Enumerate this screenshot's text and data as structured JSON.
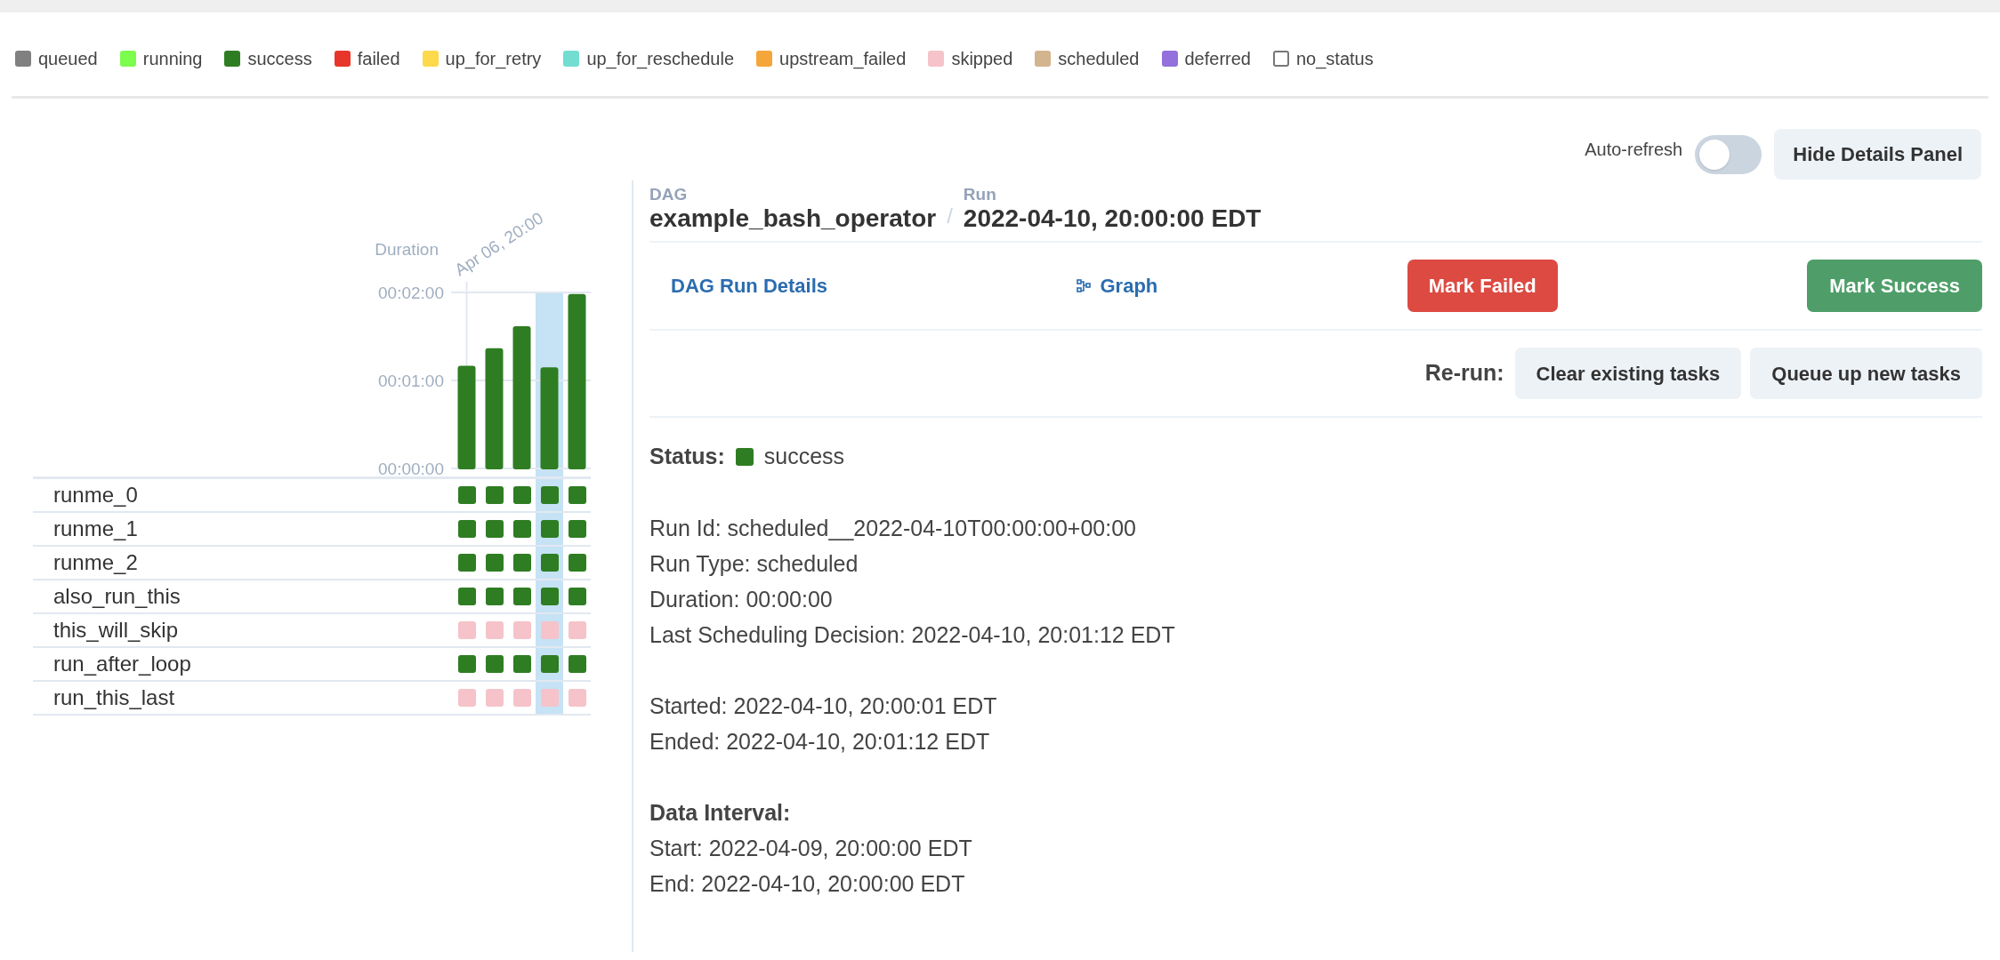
{
  "legend": [
    {
      "label": "queued",
      "color": "#808080",
      "kind": "filled"
    },
    {
      "label": "running",
      "color": "#7cfc4c",
      "kind": "filled"
    },
    {
      "label": "success",
      "color": "#2f7d22",
      "kind": "filled"
    },
    {
      "label": "failed",
      "color": "#e8352a",
      "kind": "filled"
    },
    {
      "label": "up_for_retry",
      "color": "#fdd94b",
      "kind": "filled"
    },
    {
      "label": "up_for_reschedule",
      "color": "#72ddd0",
      "kind": "filled"
    },
    {
      "label": "upstream_failed",
      "color": "#f5a63a",
      "kind": "filled"
    },
    {
      "label": "skipped",
      "color": "#f5c3c9",
      "kind": "filled"
    },
    {
      "label": "scheduled",
      "color": "#d2b48e",
      "kind": "filled"
    },
    {
      "label": "deferred",
      "color": "#9370db",
      "kind": "filled"
    },
    {
      "label": "no_status",
      "color": "#ffffff",
      "kind": "outlined"
    }
  ],
  "auto_refresh": {
    "label": "Auto-refresh",
    "on": false
  },
  "hide_details_button": "Hide Details Panel",
  "grid": {
    "chart_data": {
      "type": "bar",
      "ylabel": "Duration",
      "ylim": [
        0,
        120
      ],
      "yticks": [
        {
          "value": 0,
          "label": "00:00:00"
        },
        {
          "value": 60,
          "label": "00:01:00"
        },
        {
          "value": 120,
          "label": "00:02:00"
        }
      ],
      "values": [
        70,
        82,
        97,
        69,
        119
      ]
    },
    "first_run_label": "Apr 06, 20:00",
    "runs": [
      {
        "selected": false
      },
      {
        "selected": false
      },
      {
        "selected": false
      },
      {
        "selected": true
      },
      {
        "selected": false
      }
    ],
    "tasks": [
      {
        "name": "runme_0",
        "cells": [
          {
            "color": "#2f7d22"
          },
          {
            "color": "#2f7d22"
          },
          {
            "color": "#2f7d22"
          },
          {
            "color": "#2f7d22"
          },
          {
            "color": "#2f7d22"
          }
        ]
      },
      {
        "name": "runme_1",
        "cells": [
          {
            "color": "#2f7d22"
          },
          {
            "color": "#2f7d22"
          },
          {
            "color": "#2f7d22"
          },
          {
            "color": "#2f7d22"
          },
          {
            "color": "#2f7d22"
          }
        ]
      },
      {
        "name": "runme_2",
        "cells": [
          {
            "color": "#2f7d22"
          },
          {
            "color": "#2f7d22"
          },
          {
            "color": "#2f7d22"
          },
          {
            "color": "#2f7d22"
          },
          {
            "color": "#2f7d22"
          }
        ]
      },
      {
        "name": "also_run_this",
        "cells": [
          {
            "color": "#2f7d22"
          },
          {
            "color": "#2f7d22"
          },
          {
            "color": "#2f7d22"
          },
          {
            "color": "#2f7d22"
          },
          {
            "color": "#2f7d22"
          }
        ]
      },
      {
        "name": "this_will_skip",
        "cells": [
          {
            "color": "#f5c3c9"
          },
          {
            "color": "#f5c3c9"
          },
          {
            "color": "#f5c3c9"
          },
          {
            "color": "#f5c3c9"
          },
          {
            "color": "#f5c3c9"
          }
        ]
      },
      {
        "name": "run_after_loop",
        "cells": [
          {
            "color": "#2f7d22"
          },
          {
            "color": "#2f7d22"
          },
          {
            "color": "#2f7d22"
          },
          {
            "color": "#2f7d22"
          },
          {
            "color": "#2f7d22"
          }
        ]
      },
      {
        "name": "run_this_last",
        "cells": [
          {
            "color": "#f5c3c9"
          },
          {
            "color": "#f5c3c9"
          },
          {
            "color": "#f5c3c9"
          },
          {
            "color": "#f5c3c9"
          },
          {
            "color": "#f5c3c9"
          }
        ]
      }
    ]
  },
  "details": {
    "breadcrumb": [
      {
        "label": "DAG",
        "value": "example_bash_operator"
      },
      {
        "label": "Run",
        "value": "2022-04-10, 20:00:00 EDT"
      }
    ],
    "separator": "/",
    "actions": [
      {
        "kind": "link",
        "label": "DAG Run Details"
      },
      {
        "kind": "graph-link",
        "label": "Graph"
      },
      {
        "kind": "danger",
        "label": "Mark Failed"
      },
      {
        "kind": "success",
        "label": "Mark Success"
      }
    ],
    "rerun": {
      "label": "Re-run:",
      "buttons": [
        "Clear existing tasks",
        "Queue up new tasks"
      ]
    },
    "status": {
      "label": "Status:",
      "value": "success",
      "color": "#2f7d22"
    },
    "groups": [
      {
        "lines": [
          "Run Id: scheduled__2022-04-10T00:00:00+00:00",
          "Run Type: scheduled",
          "Duration: 00:00:00",
          "Last Scheduling Decision: 2022-04-10, 20:01:12 EDT"
        ]
      },
      {
        "lines": [
          "Started: 2022-04-10, 20:00:01 EDT",
          "Ended: 2022-04-10, 20:01:12 EDT"
        ]
      },
      {
        "heading": "Data Interval:",
        "lines": [
          "Start: 2022-04-09, 20:00:00 EDT",
          "End: 2022-04-10, 20:00:00 EDT"
        ]
      }
    ]
  }
}
